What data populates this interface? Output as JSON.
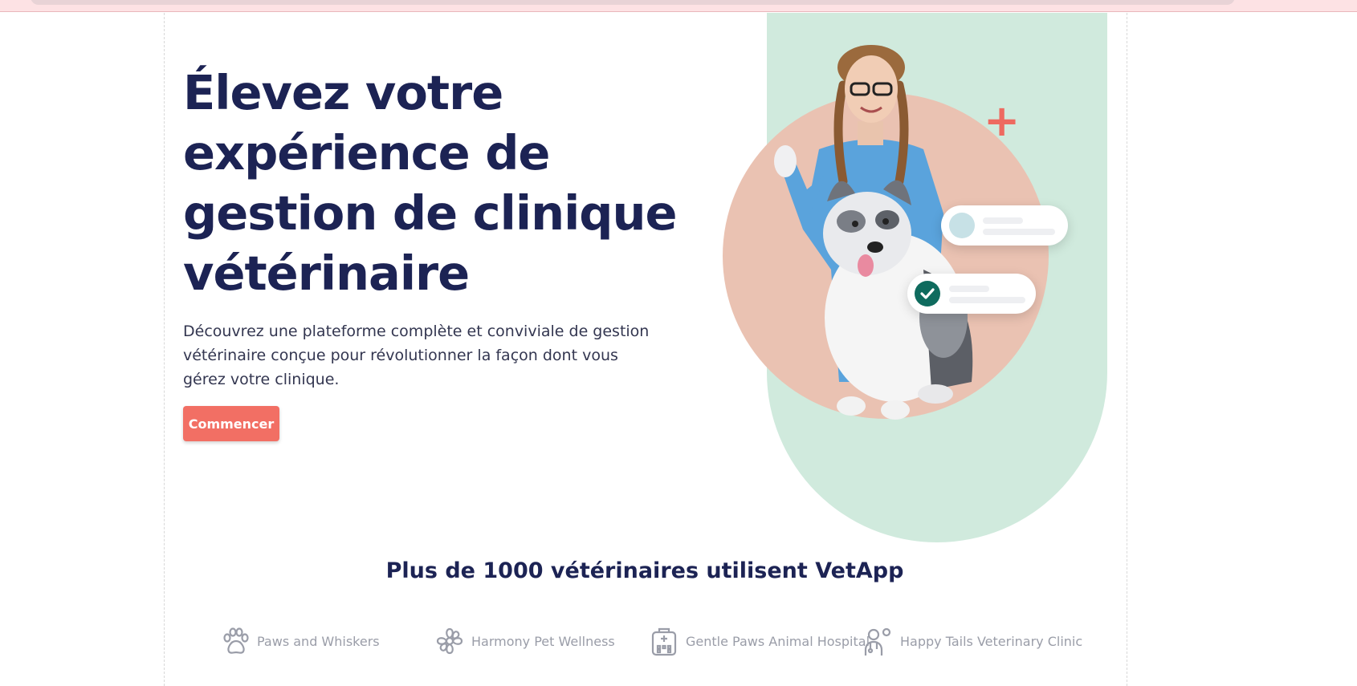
{
  "hero": {
    "title_line1": "Élevez votre",
    "title_line2": "expérience de",
    "title_line3": "gestion de clinique",
    "title_line4": "vétérinaire",
    "subtitle": "Découvrez une plateforme complète et conviviale de gestion vétérinaire conçue pour révolutionner la façon dont vous gérez votre clinique.",
    "cta_label": "Commencer"
  },
  "trust": {
    "title": "Plus de 1000 vétérinaires utilisent VetApp",
    "partners": [
      {
        "icon": "paw-icon",
        "name": "Paws and Whiskers"
      },
      {
        "icon": "flower-icon",
        "name": "Harmony Pet Wellness"
      },
      {
        "icon": "hospital-icon",
        "name": "Gentle Paws Animal Hospital"
      },
      {
        "icon": "vet-person-icon",
        "name": "Happy Tails Veterinary Clinic"
      }
    ]
  },
  "colors": {
    "heading": "#1c2354",
    "cta": "#f26f64",
    "mint": "#d0eadd",
    "peach": "#eac2b2",
    "accent_plus": "#ee6a60",
    "check": "#0f6b5e"
  }
}
